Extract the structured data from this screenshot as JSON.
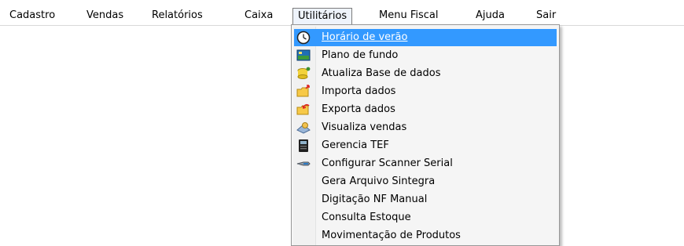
{
  "menubar": {
    "items": [
      {
        "label": "Cadastro"
      },
      {
        "label": "Vendas"
      },
      {
        "label": "Relatórios"
      },
      {
        "label": "Caixa"
      },
      {
        "label": "Utilitários",
        "active": true
      },
      {
        "label": "Menu Fiscal"
      },
      {
        "label": "Ajuda"
      },
      {
        "label": "Sair"
      }
    ]
  },
  "dropdown": {
    "items": [
      {
        "label": "Horário de verão",
        "icon": "clock-icon",
        "highlighted": true
      },
      {
        "label": "Plano de fundo",
        "icon": "wallpaper-icon"
      },
      {
        "label": "Atualiza Base de dados",
        "icon": "database-update-icon"
      },
      {
        "label": "Importa dados",
        "icon": "folder-import-icon"
      },
      {
        "label": "Exporta dados",
        "icon": "folder-export-icon"
      },
      {
        "label": "Visualiza vendas",
        "icon": "sales-view-icon"
      },
      {
        "label": "Gerencia TEF",
        "icon": "tef-terminal-icon"
      },
      {
        "label": "Configurar Scanner Serial",
        "icon": "barcode-scanner-icon"
      },
      {
        "label": "Gera Arquivo Sintegra",
        "icon": ""
      },
      {
        "label": "Digitação NF Manual",
        "icon": ""
      },
      {
        "label": "Consulta Estoque",
        "icon": ""
      },
      {
        "label": "Movimentação de Produtos",
        "icon": ""
      }
    ]
  },
  "colors": {
    "highlight": "#3399ff",
    "menu_bg": "#f5f5f5",
    "active_menu_bg": "#eef3fb"
  }
}
